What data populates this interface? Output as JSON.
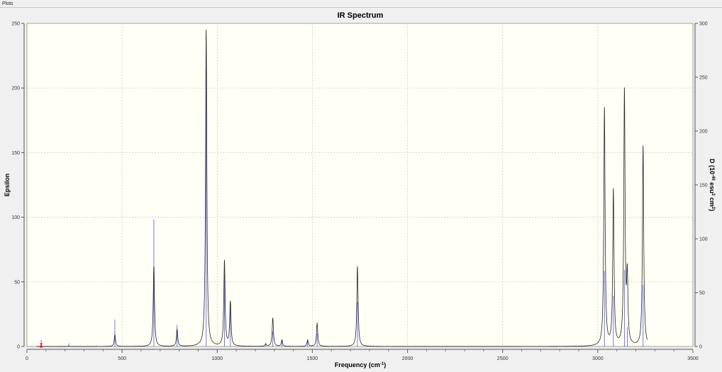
{
  "window": {
    "title": "Plots"
  },
  "chart_data": {
    "type": "line",
    "title": "IR Spectrum",
    "xlabel": "Frequency (cm",
    "xlabel_sup": "-1",
    "xlabel_end": ")",
    "ylabel": "Epsilon",
    "ylabel_right": "D (10^-40 esu^2 cm^2)",
    "xlim": [
      0,
      3500
    ],
    "ylim": [
      0,
      250
    ],
    "ylim_right": [
      0,
      300
    ],
    "x_ticks": [
      0,
      500,
      1000,
      1500,
      2000,
      2500,
      3000,
      3500
    ],
    "y_ticks": [
      0,
      50,
      100,
      150,
      200,
      250
    ],
    "y_ticks_right": [
      0,
      50,
      100,
      150,
      200,
      250,
      300
    ],
    "grid": true,
    "colors": {
      "spectrum": "#000000",
      "sticks": "#3333ff",
      "background": "#fffff5",
      "marker": "#ff0000"
    },
    "series": [
      {
        "type": "line",
        "axis": "left"
      },
      {
        "type": "stick",
        "axis": "right"
      }
    ],
    "peaks": [
      {
        "frequency": 75,
        "epsilon": 0.5,
        "D": 6
      },
      {
        "frequency": 220,
        "epsilon": 0.3,
        "D": 3
      },
      {
        "frequency": 462,
        "epsilon": 9,
        "D": 25
      },
      {
        "frequency": 667,
        "epsilon": 62,
        "D": 118
      },
      {
        "frequency": 789,
        "epsilon": 13,
        "D": 20
      },
      {
        "frequency": 942,
        "epsilon": 245,
        "D": 258
      },
      {
        "frequency": 1038,
        "epsilon": 66,
        "D": 67
      },
      {
        "frequency": 1069,
        "epsilon": 34,
        "D": 41
      },
      {
        "frequency": 1255,
        "epsilon": 2,
        "D": 2
      },
      {
        "frequency": 1292,
        "epsilon": 22,
        "D": 14
      },
      {
        "frequency": 1340,
        "epsilon": 5,
        "D": 5
      },
      {
        "frequency": 1475,
        "epsilon": 5,
        "D": 5
      },
      {
        "frequency": 1525,
        "epsilon": 18,
        "D": 12
      },
      {
        "frequency": 1737,
        "epsilon": 62,
        "D": 41
      },
      {
        "frequency": 3035,
        "epsilon": 184,
        "D": 70
      },
      {
        "frequency": 3082,
        "epsilon": 120,
        "D": 47
      },
      {
        "frequency": 3140,
        "epsilon": 196,
        "D": 71
      },
      {
        "frequency": 3155,
        "epsilon": 50,
        "D": 18
      },
      {
        "frequency": 3238,
        "epsilon": 155,
        "D": 57
      }
    ],
    "marker_frequency": 75
  }
}
